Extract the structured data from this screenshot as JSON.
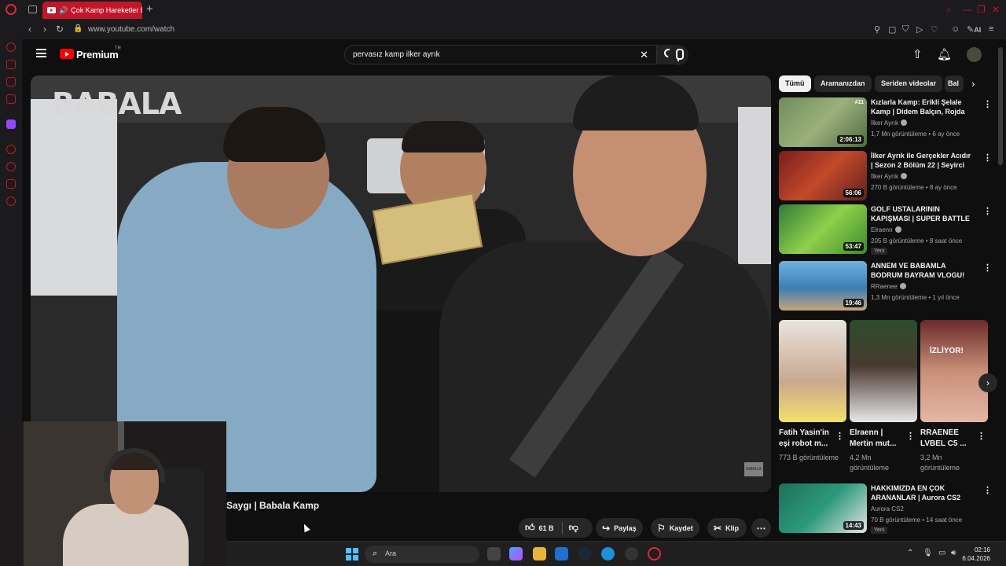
{
  "browser": {
    "tab_title": "Çok Kamp Hareketler B",
    "url": "www.youtube.com/watch",
    "toolbar_ai_label": "AI"
  },
  "youtube": {
    "brand": "Premium",
    "brand_suffix": "TR",
    "search_query": "pervasız kamp ilker ayrık"
  },
  "video": {
    "channel_logo": "BABALA",
    "watermark": "BABALA",
    "title": "Saygı | Babala Kamp",
    "likes": "61 B",
    "share_label": "Paylaş",
    "save_label": "Kaydet",
    "clip_label": "Klip",
    "more_label": "⋯"
  },
  "chips": [
    "Tümü",
    "Aramanızdan",
    "Seriden videolar",
    "Bal"
  ],
  "related": [
    {
      "title": "Kızlarla Kamp: Erikli Şelale Kamp | Didem Balçın, Rojda ...",
      "channel": "İlker Ayrık",
      "views": "1,7 Mn görüntüleme",
      "age": "6 ay önce",
      "duration": "2:06:13",
      "rank": "#11",
      "new": ""
    },
    {
      "title": "İlker Ayrık ile Gerçekler Acıdır | Sezon 2 Bölüm 22 | Seyirci ...",
      "channel": "İlker Ayrık",
      "views": "270 B görüntüleme",
      "age": "8 ay önce",
      "duration": "56:06",
      "rank": "",
      "new": ""
    },
    {
      "title": "GOLF USTALARININ KAPIŞMASI | SUPER BATTLE ...",
      "channel": "Elraenn",
      "views": "205 B görüntüleme",
      "age": "8 saat önce",
      "duration": "53:47",
      "rank": "",
      "new": "Yeni"
    },
    {
      "title": "ANNEM VE BABAMLA BODRUM BAYRAM VLOGU!",
      "channel": "RRaenee",
      "views": "1,3 Mn görüntüleme",
      "age": "1 yıl önce",
      "duration": "19:46",
      "rank": "",
      "new": ""
    }
  ],
  "shorts": [
    {
      "title": "Fatih Yasin'in eşi robot m...",
      "views": "773 B görüntüleme",
      "overlay": ""
    },
    {
      "title": "Elraenn | Mertin mut...",
      "views": "4,2 Mn görüntüleme",
      "overlay": ""
    },
    {
      "title": "RRAENEE LVBEL C5 ...",
      "views": "3,2 Mn görüntüleme",
      "overlay": "İZLİYOR!"
    }
  ],
  "related_after": {
    "title": "HAKKIMIZDA EN ÇOK ARANANLAR | Aurora CS2",
    "channel": "Aurora CS2",
    "views": "70 B görüntüleme",
    "age": "14 saat önce",
    "duration": "14:43",
    "new": "Yeni"
  },
  "taskbar": {
    "search_placeholder": "Ara",
    "time": "02:16",
    "date": "6.04.2026"
  },
  "colors": {
    "opera_red": "#c2162a",
    "yt_red": "#ff0000",
    "background": "#0f0f0f",
    "chip_bg": "#272727"
  }
}
